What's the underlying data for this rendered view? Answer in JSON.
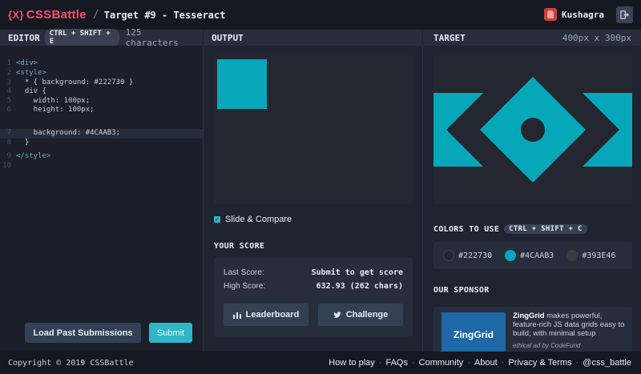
{
  "header": {
    "logo_text": "CSSBattle",
    "logo_mark": "{X}",
    "separator": "/",
    "target_title": "Target #9 - Tesseract",
    "username": "Kushagra"
  },
  "editor": {
    "label": "EDITOR",
    "shortcut": "CTRL + SHIFT + E",
    "char_count": "125 characters",
    "lines": [
      {
        "n": "1",
        "text": "<div>"
      },
      {
        "n": "2",
        "text": "<style>"
      },
      {
        "n": "3",
        "text": "  * { background: #222730 }"
      },
      {
        "n": "4",
        "text": "  div {"
      },
      {
        "n": "5",
        "text": "    width: 100px;"
      },
      {
        "n": "6",
        "text": "    height: 100px;"
      },
      {
        "n": "7",
        "text": "    background: #4CAAB3;"
      },
      {
        "n": "8",
        "text": "  }"
      },
      {
        "n": "9",
        "text": "</style>"
      },
      {
        "n": "10",
        "text": ""
      }
    ],
    "load_button": "Load Past Submissions",
    "submit_button": "Submit"
  },
  "output": {
    "label": "OUTPUT",
    "slide_label": "Slide & Compare",
    "score_title": "YOUR SCORE",
    "last_score_label": "Last Score:",
    "last_score_value": "Submit to get score",
    "high_score_label": "High Score:",
    "high_score_value": "632.93 (262 chars)",
    "leaderboard_button": "Leaderboard",
    "challenge_button": "Challenge"
  },
  "target": {
    "label": "TARGET",
    "size": "400px x 300px",
    "colors_title": "COLORS TO USE",
    "colors_shortcut": "CTRL + SHIFT + C",
    "colors": [
      {
        "hex": "#222730",
        "label": "#222730"
      },
      {
        "hex": "#4CAAB3",
        "label": "#4CAAB3"
      },
      {
        "hex": "#393E46",
        "label": "#393E46"
      }
    ],
    "sponsor_title": "OUR SPONSOR",
    "sponsor_logo": "ZingGrid",
    "sponsor_name": "ZingGrid",
    "sponsor_desc": " makes powerful, feature-rich JS data grids easy to build, with minimal setup",
    "sponsor_ad": "ethical ad by CodeFund"
  },
  "footer": {
    "copyright": "Copyright © 2019 CSSBattle",
    "links": [
      "How to play",
      "FAQs",
      "Community",
      "About",
      "Privacy & Terms",
      "@css_battle"
    ]
  },
  "theme": {
    "accent": "#2fb7c7",
    "brand": "#ff4d6d",
    "target_shape": "#06a7b9"
  }
}
